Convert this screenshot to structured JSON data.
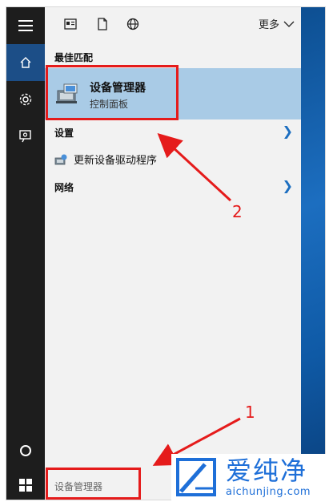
{
  "start_menu": {
    "topbar": {
      "more_label": "更多",
      "icons": [
        "news-icon",
        "document-icon",
        "web-icon",
        "chevron-down-icon"
      ]
    },
    "best_match": {
      "section_label": "最佳匹配",
      "title": "设备管理器",
      "subtitle": "控制面板",
      "icon": "device-manager-icon"
    },
    "settings": {
      "section_label": "设置",
      "item_label": "更新设备驱动程序",
      "item_icon": "driver-update-icon"
    },
    "web": {
      "section_label": "网络"
    },
    "rail_icons": [
      "hamburger-menu-icon",
      "home-icon",
      "settings-gear-icon",
      "feedback-icon",
      "cortana-circle-icon"
    ]
  },
  "taskbar": {
    "start_icon": "windows-logo-icon",
    "search_text": "设备管理器"
  },
  "annotations": {
    "callout_1": "1",
    "callout_2": "2",
    "highlight_color": "#e51b1b"
  },
  "watermark": {
    "brand_cn": "爱纯净",
    "url": "aichunjing.com",
    "color": "#1e6fd8"
  },
  "colors": {
    "rail_bg": "#1d1d1d",
    "rail_active": "#1c4e87",
    "panel_bg": "#f2f2f2",
    "selection_bg": "#a9cbe6",
    "accent": "#1c6ec0"
  }
}
